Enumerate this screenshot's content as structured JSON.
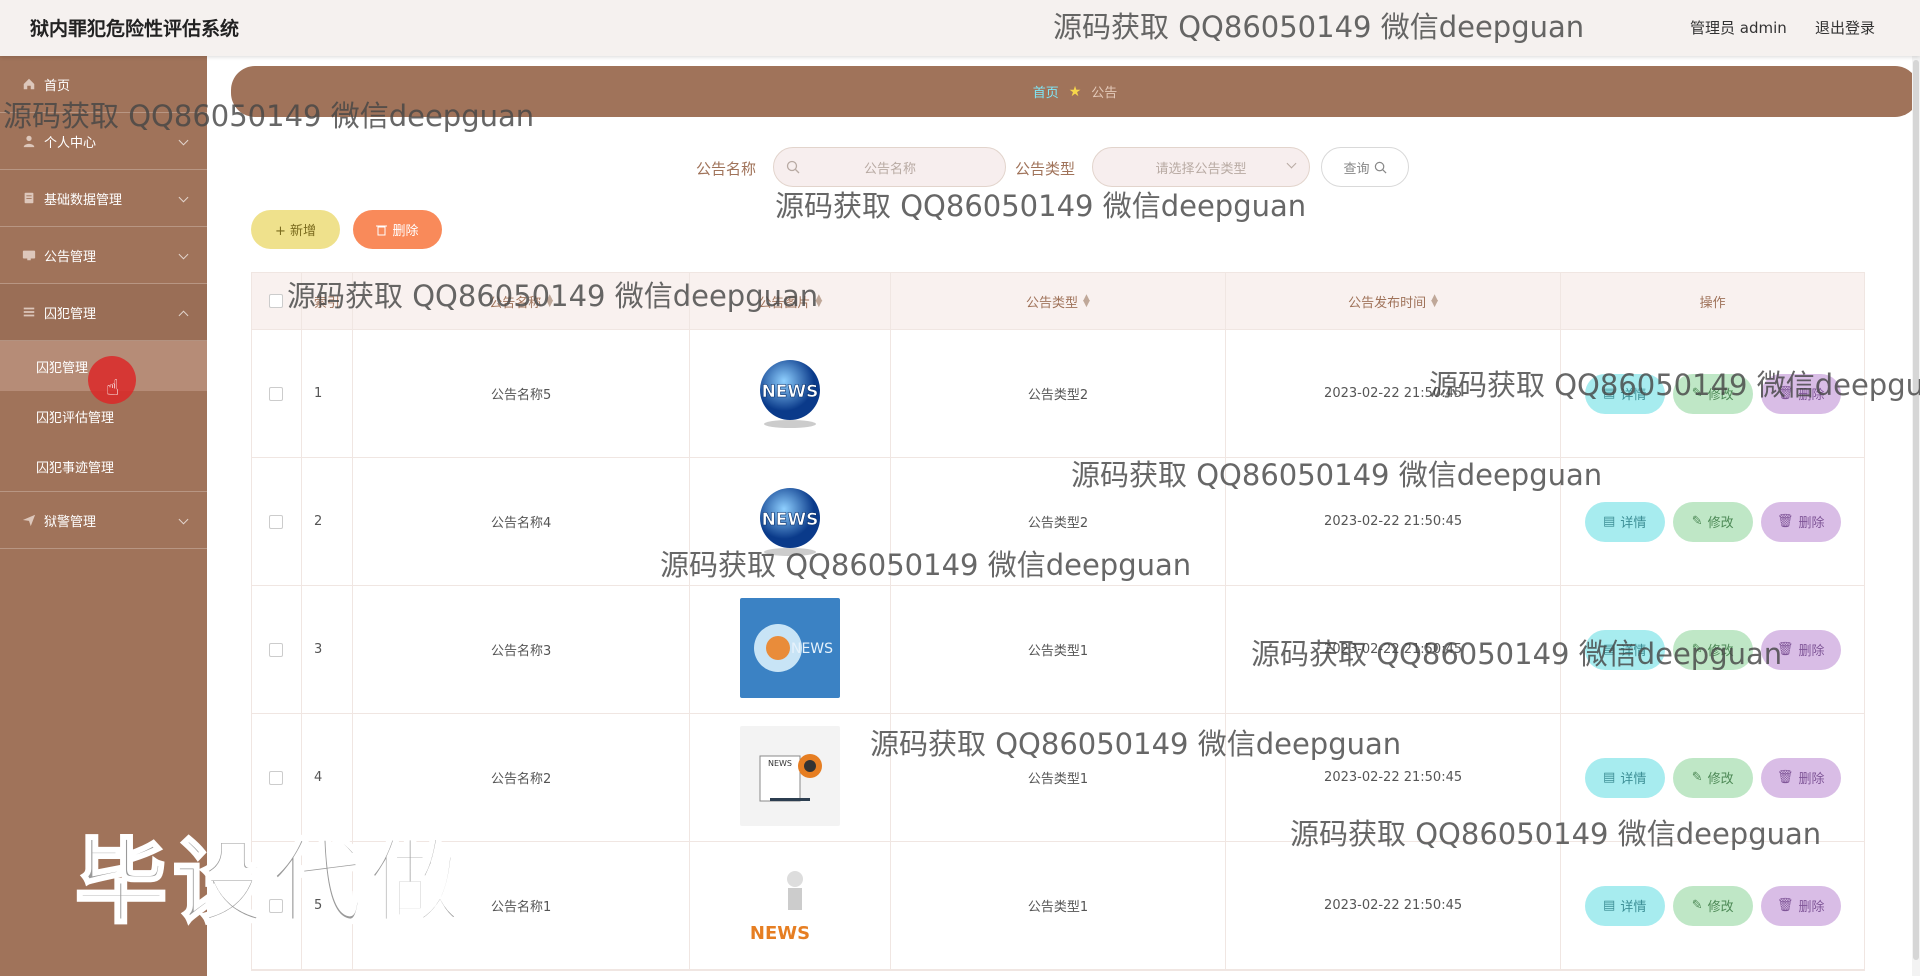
{
  "header": {
    "title": "狱内罪犯危险性评估系统",
    "admin_label": "管理员 admin",
    "logout_label": "退出登录"
  },
  "sidebar": {
    "items": [
      {
        "label": "首页",
        "icon": "home-icon"
      },
      {
        "label": "个人中心",
        "icon": "user-icon"
      },
      {
        "label": "基础数据管理",
        "icon": "database-icon"
      },
      {
        "label": "公告管理",
        "icon": "monitor-icon"
      },
      {
        "label": "囚犯管理",
        "icon": "list-icon"
      },
      {
        "label": "狱警管理",
        "icon": "send-icon"
      }
    ],
    "subitems": [
      {
        "label": "囚犯管理"
      },
      {
        "label": "囚犯评估管理"
      },
      {
        "label": "囚犯事迹管理"
      }
    ]
  },
  "breadcrumb": {
    "home": "首页",
    "current": "公告"
  },
  "search": {
    "name_label": "公告名称",
    "name_placeholder": "公告名称",
    "type_label": "公告类型",
    "type_placeholder": "请选择公告类型",
    "query_label": "查询"
  },
  "toolbar": {
    "add_label": "+ 新增",
    "delete_label": "删除"
  },
  "table": {
    "columns": [
      "索引",
      "公告名称",
      "公告图片",
      "公告类型",
      "公告发布时间",
      "操作"
    ],
    "rows": [
      {
        "index": "1",
        "name": "公告名称5",
        "image": "news-globe-icon",
        "type": "公告类型2",
        "time": "2023-02-22 21:50:45"
      },
      {
        "index": "2",
        "name": "公告名称4",
        "image": "news-globe-icon",
        "type": "公告类型2",
        "time": "2023-02-22 21:50:45"
      },
      {
        "index": "3",
        "name": "公告名称3",
        "image": "news-blue-icon",
        "type": "公告类型1",
        "time": "2023-02-22 21:50:45"
      },
      {
        "index": "4",
        "name": "公告名称2",
        "image": "news-paper-icon",
        "type": "公告类型1",
        "time": "2023-02-22 21:50:45"
      },
      {
        "index": "5",
        "name": "公告名称1",
        "image": "news-figure-icon",
        "type": "公告类型1",
        "time": "2023-02-22 21:50:45"
      }
    ],
    "actions": {
      "detail": "详情",
      "edit": "修改",
      "delete": "删除"
    }
  },
  "watermarks": {
    "text": "源码获取 QQ86050149 微信deepguan",
    "big": "毕设代做"
  },
  "colors": {
    "brand": "#a0735a",
    "detail": "#a7ecef",
    "edit": "#bfe7c6",
    "delete": "#d9bde6",
    "add": "#efe18c",
    "delete_batch": "#f98a5a"
  }
}
